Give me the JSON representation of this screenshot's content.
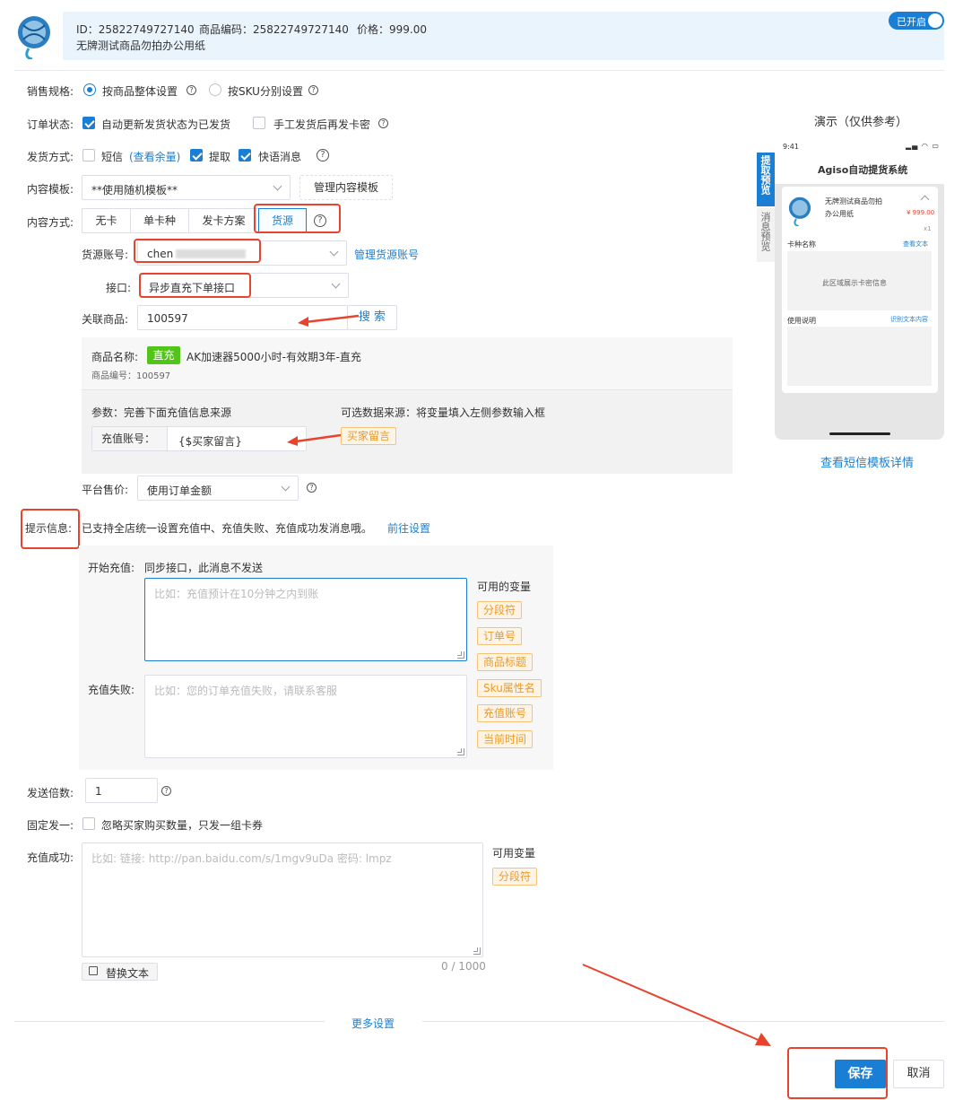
{
  "header": {
    "id_text": "ID：25822749727140",
    "code_text": "商品编码：25822749727140",
    "price_text": "价格：999.00",
    "product_name": "无牌测试商品勿拍办公用纸",
    "toggle_label": "已开启"
  },
  "form": {
    "sales_spec": {
      "label": "销售规格:",
      "option1": "按商品整体设置",
      "option2": "按SKU分别设置"
    },
    "order_status": {
      "label": "订单状态:",
      "option1": "自动更新发货状态为已发货",
      "option2": "手工发货后再发卡密"
    },
    "delivery": {
      "label": "发货方式:",
      "sms": "短信",
      "sms_link": "(查看余量)",
      "pickup": "提取",
      "quick_msg": "快语消息"
    },
    "template": {
      "label": "内容模板:",
      "value": "**使用随机模板**",
      "manage_button": "管理内容模板"
    },
    "content_mode": {
      "label": "内容方式:",
      "tabs": [
        "无卡",
        "单卡种",
        "发卡方案",
        "货源"
      ]
    },
    "source_account": {
      "label": "货源账号:",
      "value": "chen",
      "manage_link": "管理货源账号"
    },
    "interface": {
      "label": "接口:",
      "value": "异步直充下单接口"
    },
    "related_product": {
      "label": "关联商品:",
      "value": "100597",
      "search_button": "搜 索"
    },
    "product_card": {
      "name_label": "商品名称:",
      "badge": "直充",
      "name": "AK加速器5000小时-有效期3年-直充",
      "code_text": "商品编号：100597",
      "params_label": "参数：完善下面充值信息来源",
      "optional_label": "可选数据来源：将变量填入左侧参数输入框",
      "recharge_account_label": "充值账号：",
      "recharge_account_value": "{$买家留言}",
      "buyer_msg_tag": "买家留言"
    },
    "platform_price": {
      "label": "平台售价:",
      "value": "使用订单金额"
    },
    "hint": {
      "label": "提示信息:",
      "text": "已支持全店统一设置充值中、充值失败、充值成功发消息哦。",
      "link": "前往设置"
    },
    "messages": {
      "start_label": "开始充值:",
      "start_note": "同步接口，此消息不发送",
      "start_placeholder": "比如：充值预计在10分钟之内到账",
      "fail_label": "充值失败:",
      "fail_placeholder": "比如：您的订单充值失败，请联系客服",
      "vars_label": "可用的变量",
      "vars": [
        "分段符",
        "订单号",
        "商品标题",
        "Sku属性名",
        "充值账号",
        "当前时间"
      ]
    },
    "send_multiple": {
      "label": "发送倍数:",
      "value": "1"
    },
    "fixed_one": {
      "label": "固定发一:",
      "text": "忽略买家购买数量，只发一组卡券"
    },
    "success": {
      "label": "充值成功:",
      "placeholder": "比如: 链接: http://pan.baidu.com/s/1mgv9uDa 密码: lmpz",
      "vars_label": "可用变量",
      "var": "分段符",
      "replace_button": "替换文本",
      "counter": "0 / 1000"
    },
    "more_settings": "更多设置"
  },
  "preview": {
    "title": "演示（仅供参考）",
    "tab_active": "提取预览",
    "tab_inactive": "消息预览",
    "time": "9:41",
    "app_title": "Agiso自动提货系统",
    "product_name": "无牌测试商品勿拍办公用纸",
    "price": "¥ 999.00",
    "qty": "x1",
    "card_name_label": "卡种名称",
    "view_text": "查看文本",
    "area_text": "此区域展示卡密信息",
    "usage_label": "使用说明",
    "recognize_text": "识别文本内容",
    "sms_link": "查看短信模板详情"
  },
  "actions": {
    "save": "保存",
    "cancel": "取消"
  },
  "colors": {
    "primary": "#1a7fd4",
    "annotation": "#e8432e",
    "tag": "#e99a2b",
    "badge": "#52c41a"
  }
}
